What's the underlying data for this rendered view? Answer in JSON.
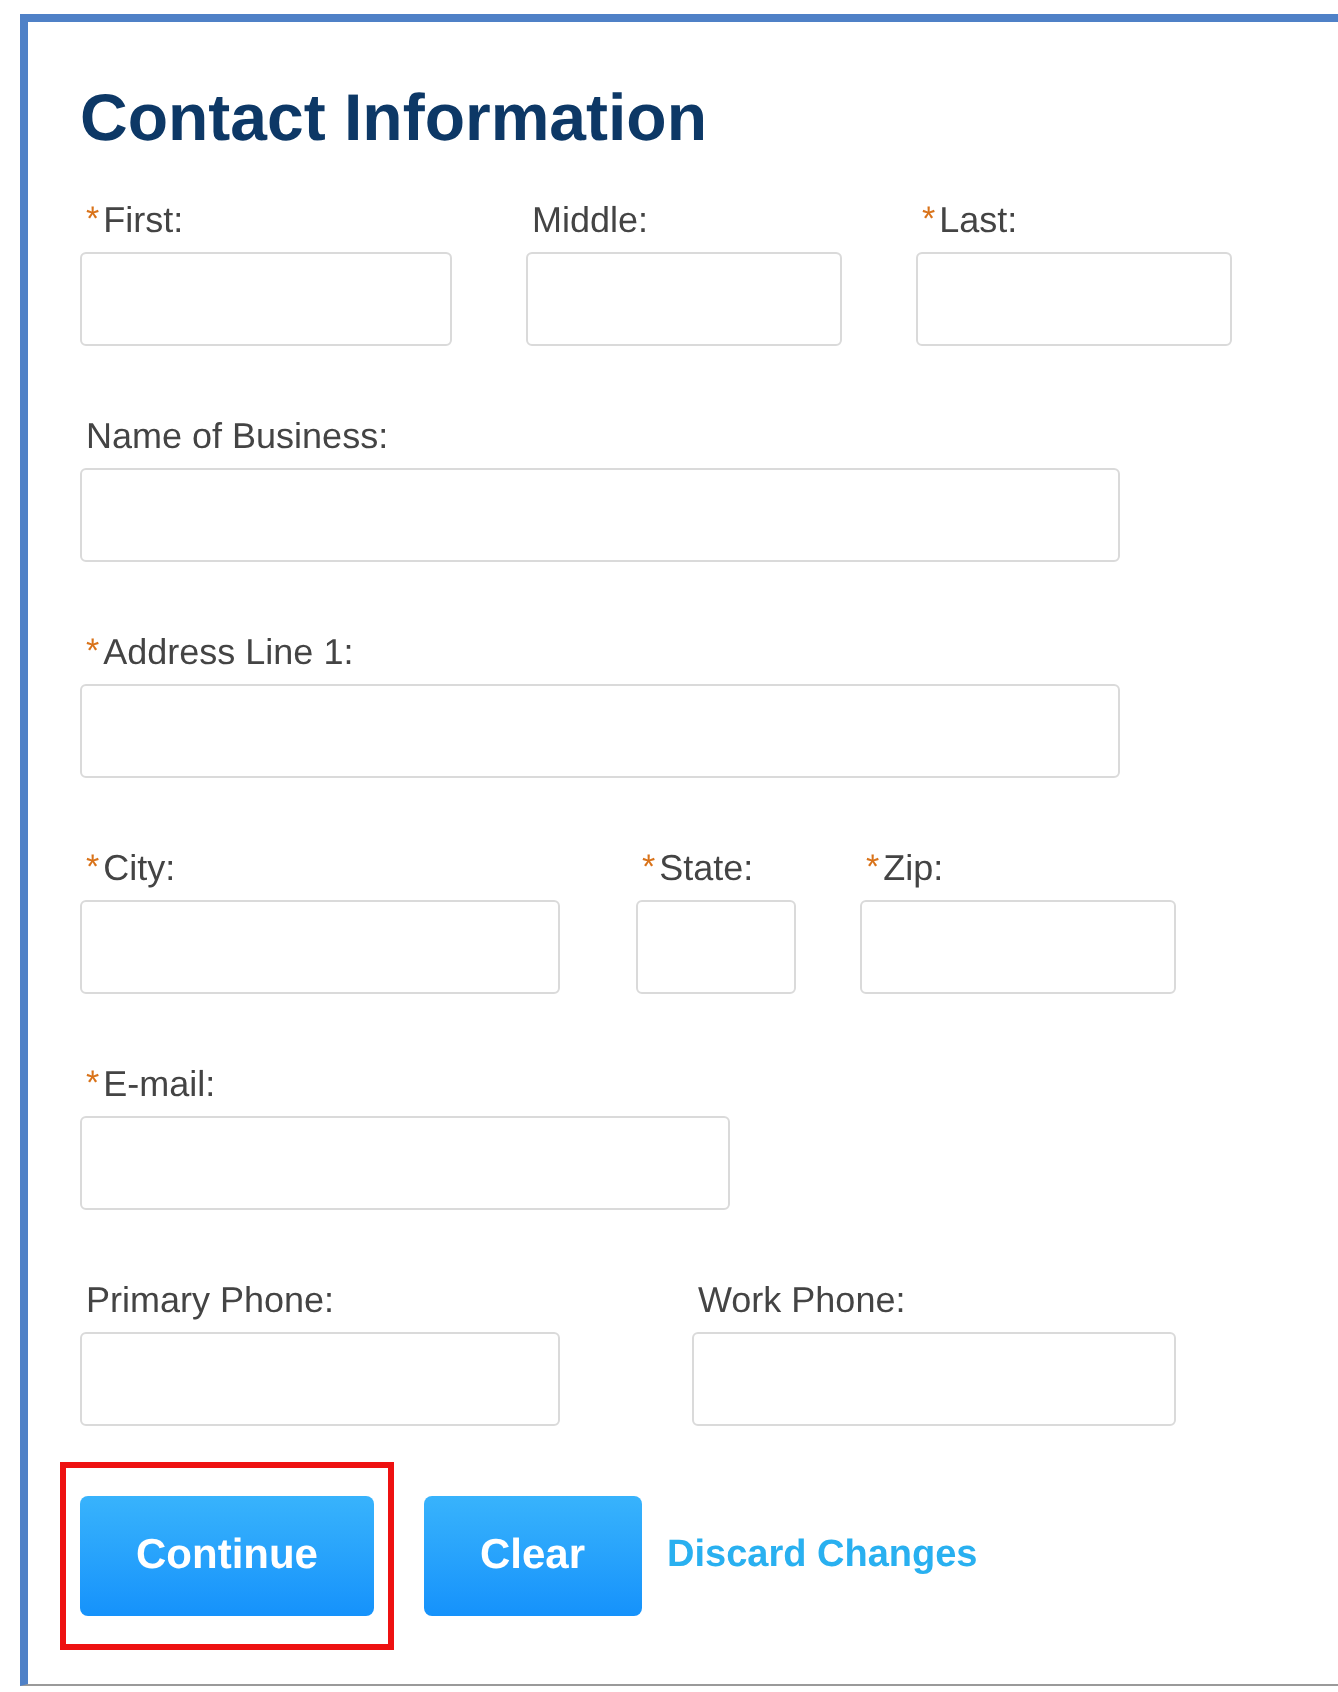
{
  "title": "Contact Information",
  "rows": [
    {
      "fields": [
        {
          "label": "First:",
          "required": true
        },
        {
          "label": "Middle:",
          "required": false
        },
        {
          "label": "Last:",
          "required": true
        }
      ]
    },
    {
      "fields": [
        {
          "label": "Name of Business:",
          "required": false
        }
      ]
    },
    {
      "fields": [
        {
          "label": "Address Line 1:",
          "required": true
        }
      ]
    },
    {
      "fields": [
        {
          "label": "City:",
          "required": true
        },
        {
          "label": "State:",
          "required": true
        },
        {
          "label": "Zip:",
          "required": true
        }
      ]
    },
    {
      "fields": [
        {
          "label": "E-mail:",
          "required": true
        }
      ]
    },
    {
      "fields": [
        {
          "label": "Primary Phone:",
          "required": false
        },
        {
          "label": "Work Phone:",
          "required": false
        }
      ]
    }
  ],
  "required_mark": "*",
  "buttons": [
    {
      "label": "Continue",
      "kind": "button",
      "highlighted": true
    },
    {
      "label": "Clear",
      "kind": "button",
      "highlighted": false
    },
    {
      "label": "Discard Changes",
      "kind": "link",
      "highlighted": false
    }
  ]
}
